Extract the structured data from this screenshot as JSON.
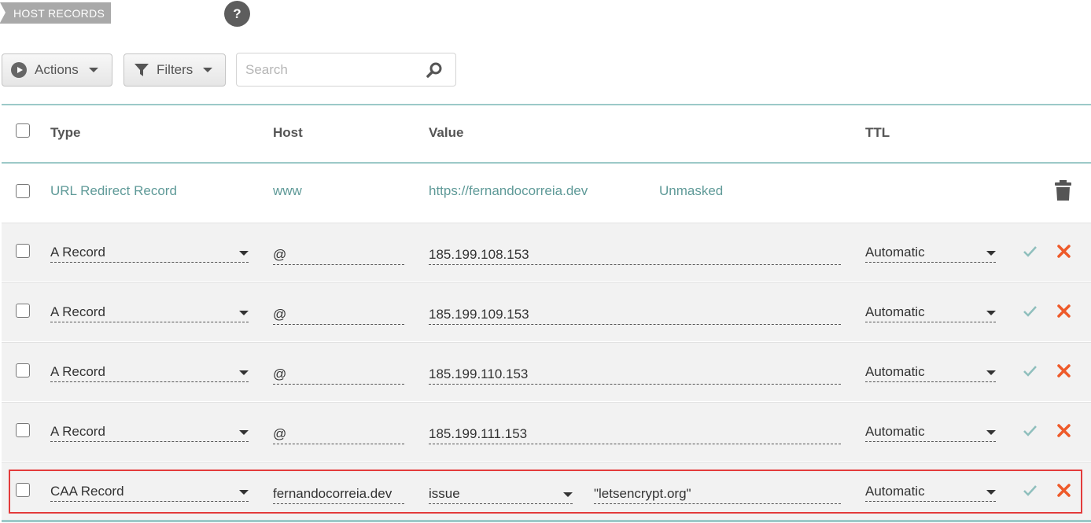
{
  "section": {
    "title": "HOST RECORDS",
    "help_icon": "help-icon",
    "help_glyph": "?"
  },
  "toolbar": {
    "actions_label": "Actions",
    "filters_label": "Filters",
    "search_placeholder": "Search",
    "search_value": ""
  },
  "table": {
    "headers": {
      "type": "Type",
      "host": "Host",
      "value": "Value",
      "ttl": "TTL"
    },
    "redirect_row": {
      "type": "URL Redirect Record",
      "host": "www",
      "value": "https://fernandocorreia.dev",
      "mask": "Unmasked"
    },
    "edit_rows": [
      {
        "type": "A Record",
        "host": "@",
        "value": "185.199.108.153",
        "ttl": "Automatic"
      },
      {
        "type": "A Record",
        "host": "@",
        "value": "185.199.109.153",
        "ttl": "Automatic"
      },
      {
        "type": "A Record",
        "host": "@",
        "value": "185.199.110.153",
        "ttl": "Automatic"
      },
      {
        "type": "A Record",
        "host": "@",
        "value": "185.199.111.153",
        "ttl": "Automatic"
      },
      {
        "type": "CAA Record",
        "host": "fernandocorreia.dev",
        "tag": "issue",
        "value": "\"letsencrypt.org\"",
        "ttl": "Automatic"
      }
    ]
  },
  "colors": {
    "accent_teal": "#5f9a98",
    "table_border": "#9cc9c8",
    "confirm_check": "#8fbfbd",
    "cancel_x": "#ee5a2a",
    "highlight_border": "#e33b3b"
  }
}
